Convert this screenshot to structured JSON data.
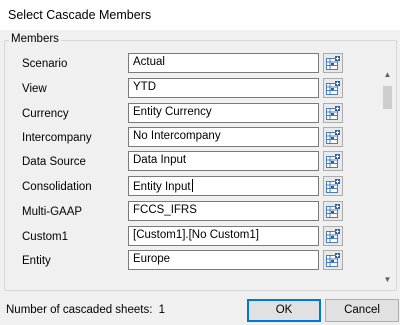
{
  "window": {
    "title": "Select Cascade Members"
  },
  "group": {
    "label": "Members"
  },
  "members": [
    {
      "label": "Scenario",
      "value": "Actual"
    },
    {
      "label": "View",
      "value": "YTD"
    },
    {
      "label": "Currency",
      "value": "Entity Currency"
    },
    {
      "label": "Intercompany",
      "value": "No Intercompany"
    },
    {
      "label": "Data Source",
      "value": "Data Input"
    },
    {
      "label": "Consolidation",
      "value": "Entity Input"
    },
    {
      "label": "Multi-GAAP",
      "value": "FCCS_IFRS"
    },
    {
      "label": "Custom1",
      "value": "[Custom1].[No Custom1]"
    },
    {
      "label": "Entity",
      "value": "Europe"
    }
  ],
  "footer": {
    "sheets_label": "Number of cascaded sheets:",
    "sheets_count": "1"
  },
  "buttons": {
    "ok": "OK",
    "cancel": "Cancel"
  },
  "icons": {
    "member_picker": "member-selector-icon",
    "scroll_up": "chevron-up-icon",
    "scroll_down": "chevron-down-icon"
  },
  "colors": {
    "accent": "#0078d7",
    "field_border": "#7a7a7a"
  }
}
